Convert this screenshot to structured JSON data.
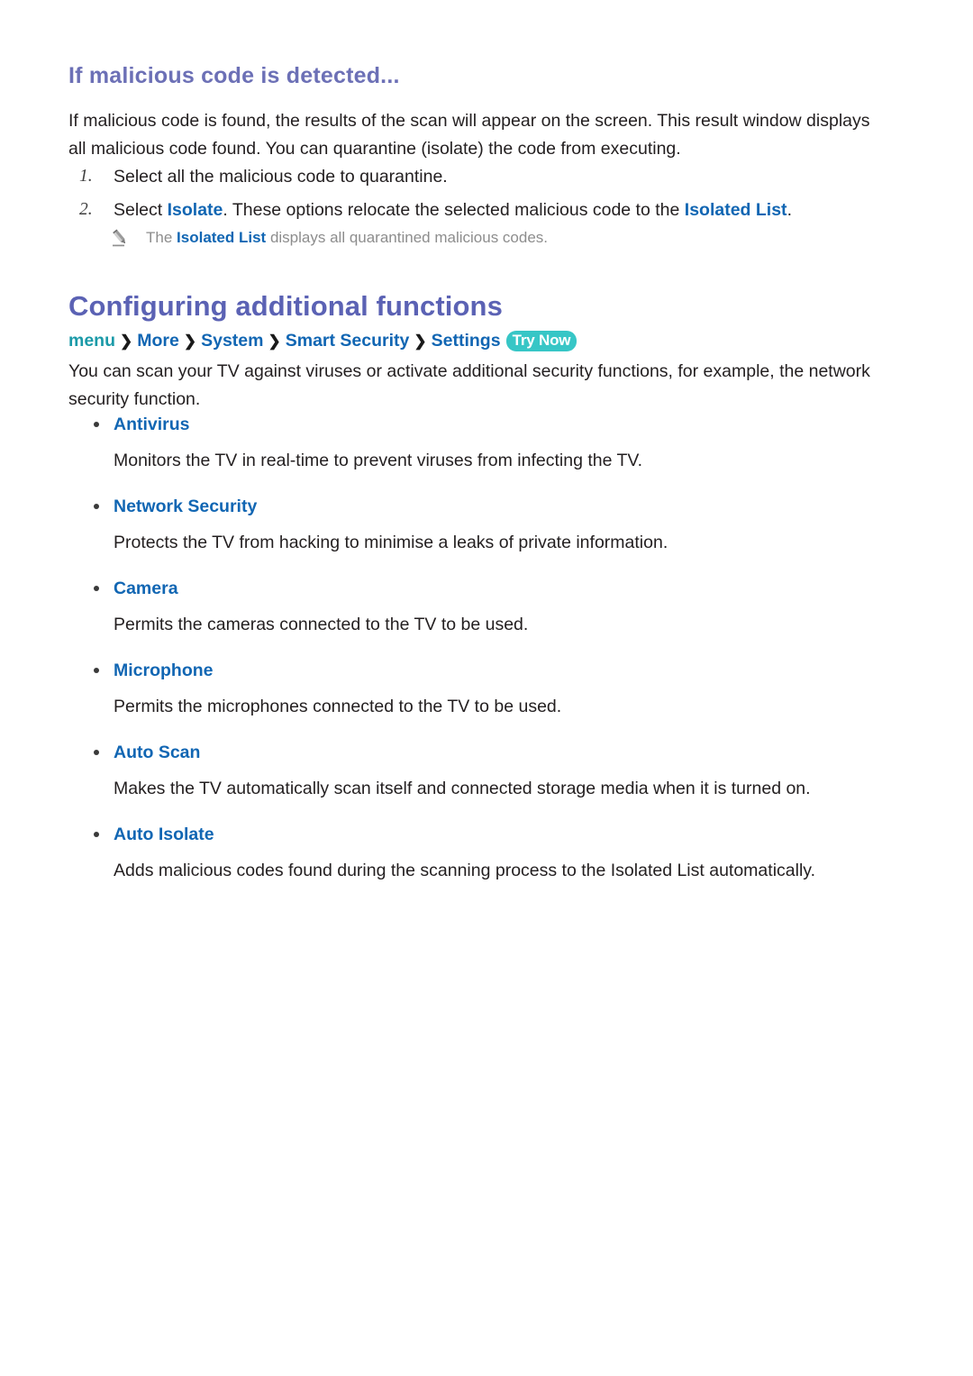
{
  "section": {
    "heading": "If malicious code is detected...",
    "intro_paragraph": "If malicious code is found, the results of the scan will appear on the screen. This result window displays all malicious code found. You can quarantine (isolate) the code from executing.",
    "steps": [
      {
        "number": "1.",
        "text_before": "Select all the malicious code to quarantine.",
        "keyword": "",
        "text_after": ""
      },
      {
        "number": "2.",
        "text_before": "Select ",
        "keyword": "Isolate",
        "text_middle": ". These options relocate the selected malicious code to the ",
        "keyword2": "Isolated List",
        "text_after": "."
      }
    ],
    "note": {
      "icon": "pencil-icon",
      "text_before": "The ",
      "keyword": "Isolated List",
      "text_after": " displays all quarantined malicious codes."
    }
  },
  "main_section": {
    "title": "Configuring additional functions",
    "breadcrumb": {
      "items": [
        "menu",
        "More",
        "System",
        "Smart Security",
        "Settings"
      ],
      "separator": "❯",
      "badge": "Try Now"
    },
    "paragraph": "You can scan your TV against viruses or activate additional security functions, for example, the network security function.",
    "features": [
      {
        "term": "Antivirus",
        "description": "Monitors the TV in real-time to prevent viruses from infecting the TV."
      },
      {
        "term": "Network Security",
        "description": "Protects the TV from hacking to minimise a leaks of private information."
      },
      {
        "term": "Camera",
        "description": "Permits the cameras connected to the TV to be used."
      },
      {
        "term": "Microphone",
        "description": "Permits the microphones connected to the TV to be used."
      },
      {
        "term": "Auto Scan",
        "description": "Makes the TV automatically scan itself and connected storage media when it is turned on."
      },
      {
        "term": "Auto Isolate",
        "description": "Adds malicious codes found during the scanning process to the Isolated List automatically."
      }
    ]
  },
  "colors": {
    "heading_purple": "#6c70b6",
    "title_purple": "#5b62b4",
    "link_blue": "#1166b3",
    "menu_teal": "#1b9aa8",
    "badge_teal": "#37c6c6",
    "note_gray": "#8d8d8d",
    "body_text": "#231f20"
  }
}
